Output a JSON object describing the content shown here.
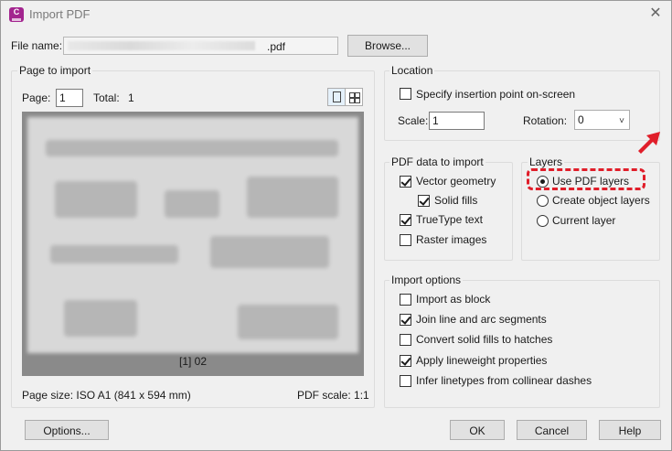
{
  "window": {
    "title": "Import PDF",
    "icon": "autocad-icon"
  },
  "file": {
    "label": "File name:",
    "value": ".pdf",
    "browse_label": "Browse..."
  },
  "page_to_import": {
    "legend": "Page to import",
    "page_label": "Page:",
    "page_value": "1",
    "total_label": "Total:",
    "total_value": "1",
    "preview_caption": "[1] 02",
    "page_size": "Page size:  ISO A1 (841 x 594 mm)",
    "pdf_scale": "PDF scale:  1:1"
  },
  "location": {
    "legend": "Location",
    "specify_label": "Specify insertion point on-screen",
    "specify_checked": false,
    "scale_label": "Scale:",
    "scale_value": "1",
    "rotation_label": "Rotation:",
    "rotation_value": "0"
  },
  "pdf_data": {
    "legend": "PDF data to import",
    "items": [
      {
        "label": "Vector geometry",
        "checked": true
      },
      {
        "label": "Solid fills",
        "checked": true
      },
      {
        "label": "TrueType text",
        "checked": true
      },
      {
        "label": "Raster images",
        "checked": false
      }
    ]
  },
  "layers": {
    "legend": "Layers",
    "options": [
      {
        "label": "Use PDF layers",
        "selected": true
      },
      {
        "label": "Create object layers",
        "selected": false
      },
      {
        "label": "Current layer",
        "selected": false
      }
    ]
  },
  "import_options": {
    "legend": "Import options",
    "items": [
      {
        "label": "Import as block",
        "checked": false
      },
      {
        "label": "Join line and arc segments",
        "checked": true
      },
      {
        "label": "Convert solid fills to hatches",
        "checked": false
      },
      {
        "label": "Apply lineweight properties",
        "checked": true
      },
      {
        "label": "Infer linetypes from collinear dashes",
        "checked": false
      }
    ]
  },
  "buttons": {
    "options": "Options...",
    "ok": "OK",
    "cancel": "Cancel",
    "help": "Help"
  },
  "colors": {
    "highlight": "#e01e2a",
    "app_icon": "#a3258f"
  }
}
